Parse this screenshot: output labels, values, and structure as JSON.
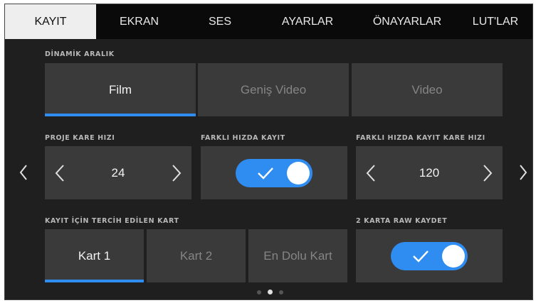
{
  "tabs": [
    {
      "label": "KAYIT",
      "active": true
    },
    {
      "label": "EKRAN",
      "active": false
    },
    {
      "label": "SES",
      "active": false
    },
    {
      "label": "AYARLAR",
      "active": false
    },
    {
      "label": "ÖNAYARLAR",
      "active": false
    },
    {
      "label": "LUT'LAR",
      "active": false
    }
  ],
  "dynamic_range": {
    "label": "DİNAMİK ARALIK",
    "options": [
      "Film",
      "Geniş Video",
      "Video"
    ],
    "selected": "Film"
  },
  "project_frame_rate": {
    "label": "PROJE KARE HIZI",
    "value": "24"
  },
  "off_speed_recording": {
    "label": "FARKLI HIZDA KAYIT",
    "enabled": true
  },
  "off_speed_frame_rate": {
    "label": "FARKLI HIZDA KAYIT KARE HIZI",
    "value": "120"
  },
  "preferred_card": {
    "label": "KAYIT İÇİN TERCİH EDİLEN KART",
    "options": [
      "Kart 1",
      "Kart 2",
      "En Dolu Kart"
    ],
    "selected": "Kart 1"
  },
  "raw_two_cards": {
    "label": "2 KARTA RAW KAYDET",
    "enabled": true
  },
  "pagination": {
    "total": 3,
    "current": 2
  },
  "colors": {
    "accent": "#2f8cf0",
    "tile": "#3a3a3a",
    "background": "#1f1f1f",
    "tab_active": "#eeeeee"
  },
  "icons": [
    "chevron-left-icon",
    "chevron-right-icon",
    "checkmark-icon"
  ]
}
